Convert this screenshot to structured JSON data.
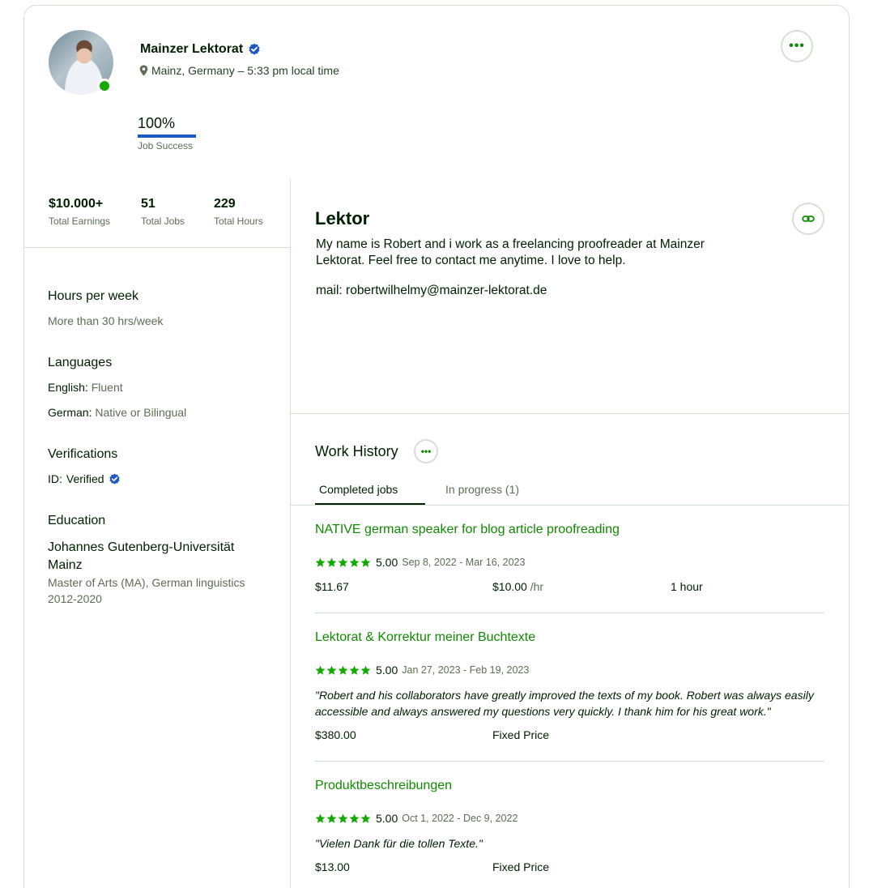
{
  "profile": {
    "name": "Mainzer Lektorat",
    "location": "Mainz, Germany – 5:33 pm local time",
    "job_success_value": "100%",
    "job_success_label": "Job Success"
  },
  "stats": [
    {
      "value": "$10.000+",
      "label": "Total Earnings"
    },
    {
      "value": "51",
      "label": "Total Jobs"
    },
    {
      "value": "229",
      "label": "Total Hours"
    }
  ],
  "sidebar": {
    "hours_title": "Hours per week",
    "hours_value": "More than 30 hrs/week",
    "languages_title": "Languages",
    "languages": [
      {
        "name": "English:",
        "level": "Fluent"
      },
      {
        "name": "German:",
        "level": "Native or Bilingual"
      }
    ],
    "verifications_title": "Verifications",
    "id_key": "ID:",
    "id_value": "Verified",
    "education_title": "Education",
    "school": "Johannes Gutenberg-Universität Mainz",
    "degree": "Master of Arts (MA), German linguistics",
    "years": "2012-2020"
  },
  "main": {
    "title": "Lektor",
    "overview_line1": "My name is Robert and i work as a freelancing proofreader at Mainzer Lektorat. Feel free to contact me anytime. I love to help.",
    "overview_line2": "mail: robertwilhelmy@mainzer-lektorat.de"
  },
  "work_history": {
    "title": "Work History",
    "tabs": [
      {
        "label": "Completed jobs"
      },
      {
        "label": "In progress (1)"
      }
    ],
    "jobs": [
      {
        "title": "NATIVE german speaker for blog article proofreading",
        "rating": "5.00",
        "dates": "Sep 8, 2022 - Mar 16, 2023",
        "earned": "$11.67",
        "rate": "$10.00",
        "rate_unit": "/hr",
        "hours": "1 hour"
      },
      {
        "title": "Lektorat & Korrektur meiner Buchtexte",
        "rating": "5.00",
        "dates": "Jan 27, 2023 - Feb 19, 2023",
        "feedback": "\"Robert and his collaborators have greatly improved the texts of my book. Robert was always easily accessible and always answered my questions very quickly. I thank him for his great work.\"",
        "earned": "$380.00",
        "price_type": "Fixed Price"
      },
      {
        "title": "Produktbeschreibungen",
        "rating": "5.00",
        "dates": "Oct 1, 2022 - Dec 9, 2022",
        "feedback": "\"Vielen Dank für die tollen Texte.\"",
        "earned": "$13.00",
        "price_type": "Fixed Price"
      }
    ]
  },
  "icons": {
    "more": "more-horizontal-icon",
    "link": "link-icon",
    "location": "location-pin-icon",
    "verified": "verified-badge-icon",
    "star": "star-icon"
  },
  "colors": {
    "brand_green": "#108a00",
    "star_green": "#14a800",
    "verified_blue": "#1f57c3",
    "online": "#14a800"
  }
}
